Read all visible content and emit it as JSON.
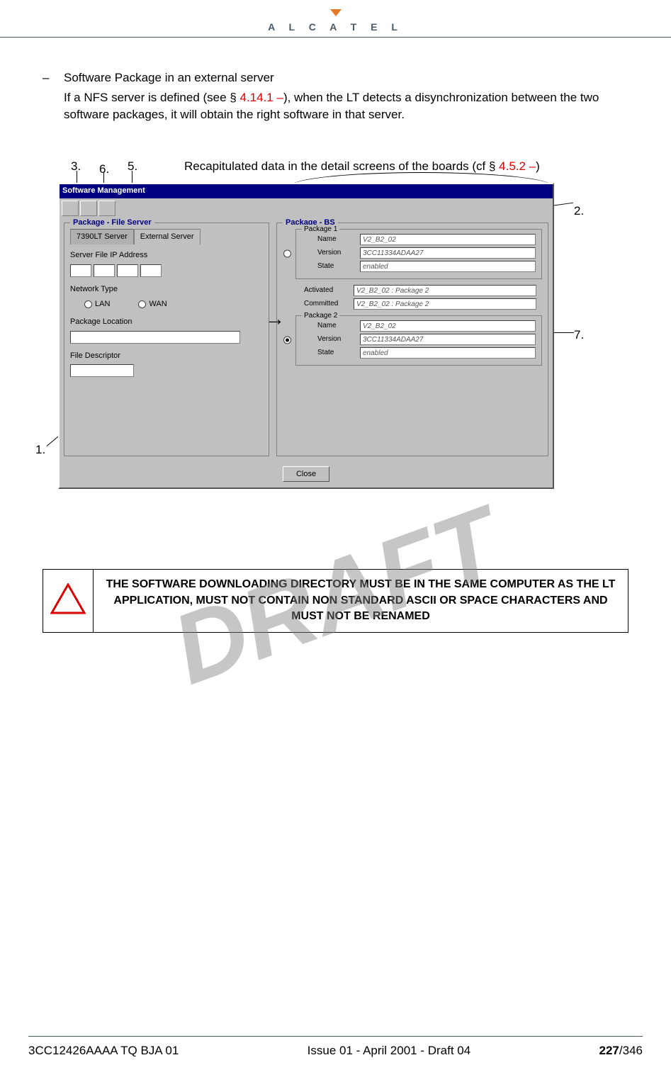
{
  "logo": {
    "brand": "A L C A T E L"
  },
  "body": {
    "bullet_dash": "–",
    "bullet_title": "Software Package in an external server",
    "bullet_desc_1": "If a NFS server is defined  (see § ",
    "bullet_ref": "4.14.1 –",
    "bullet_desc_2": "), when the LT detects a disynchronization between the two software packages, it will obtain the right software in that server."
  },
  "callouts": {
    "c1": "1.",
    "c2": "2.",
    "c3": "3.",
    "c5": "5.",
    "c6": "6.",
    "c7": "7.",
    "recap_a": "Recapitulated data in the detail screens of the boards (cf § ",
    "recap_ref": "4.5.2 –",
    "recap_b": ")"
  },
  "window": {
    "title": "Software Management",
    "left": {
      "group_title": "Package - File Server",
      "tab1": "7390LT Server",
      "tab2": "External Server",
      "ip_label": "Server File IP Address",
      "net_label": "Network Type",
      "radio_lan": "LAN",
      "radio_wan": "WAN",
      "loc_label": "Package Location",
      "desc_label": "File Descriptor"
    },
    "right": {
      "group_title": "Package - BS",
      "pkg1_title": "Package 1",
      "pkg2_title": "Package 2",
      "name_label": "Name",
      "version_label": "Version",
      "state_label": "State",
      "activated_label": "Activated",
      "committed_label": "Committed",
      "pkg1": {
        "name": "V2_B2_02",
        "version": "3CC11334ADAA27",
        "state": "enabled"
      },
      "pkg2": {
        "name": "V2_B2_02",
        "version": "3CC11334ADAA27",
        "state": "enabled"
      },
      "activated": "V2_B2_02 : Package 2",
      "committed": "V2_B2_02 : Package 2"
    },
    "close": "Close"
  },
  "warning": {
    "text": "THE SOFTWARE DOWNLOADING DIRECTORY MUST BE IN THE SAME COMPUTER AS THE LT APPLICATION, MUST NOT CONTAIN NON STANDARD ASCII OR SPACE CHARACTERS AND MUST NOT BE RENAMED"
  },
  "watermark": "DRAFT",
  "footer": {
    "left": "3CC12426AAAA TQ BJA 01",
    "center": "Issue 01 - April 2001 - Draft 04",
    "page_current": "227",
    "page_total": "/346"
  }
}
